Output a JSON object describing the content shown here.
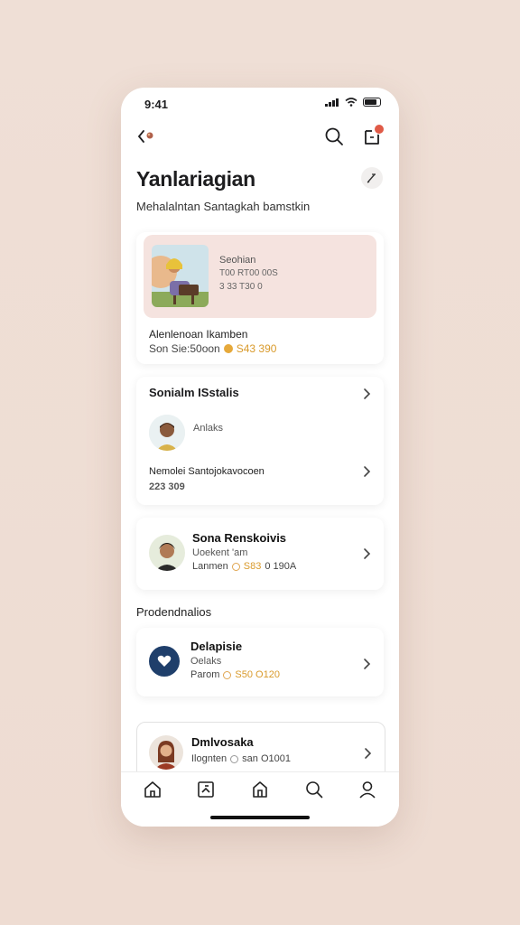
{
  "status_bar": {
    "time": "9:41"
  },
  "header": {
    "title": "Yanlariagian",
    "subtitle": "Mehalalntan Santagkah bamstkin"
  },
  "featured_card": {
    "hero_name": "Seohian",
    "hero_line1": "T00 RT00 00S",
    "hero_line2": "3 33 T30 0",
    "title": "Alenlenoan Ikamben",
    "subtitle_prefix": "Son Sie:50oon",
    "amount": "S43 390"
  },
  "section_card": {
    "title": "Sonialm ISstalis",
    "person_label": "Anlaks",
    "footer_label": "Nemolei Santojokavocoen",
    "footer_amount": "223 309"
  },
  "person_card": {
    "name": "Sona Renskoivis",
    "line1": "Uoekent 'am",
    "line2_prefix": "Lanmen",
    "line2_amount": "S83",
    "line2_suffix": "0 190A"
  },
  "section_heading": "Prodendnalios",
  "heart_card": {
    "name": "Delapisie",
    "line1": "Oelaks",
    "line2_prefix": "Parom",
    "line2_amount": "S50 O120"
  },
  "last_card": {
    "name": "Dmlvosaka",
    "line2_prefix": "Ilognten",
    "line2_suffix": "san O1001"
  },
  "colors": {
    "background": "#eedcd2",
    "accent_gold": "#d99a2b",
    "hero_bg": "#f5e3df",
    "heart_navy": "#1f3f6b",
    "notification_red": "#e05a47"
  },
  "icons": {
    "back": "chevron-left-icon",
    "search": "search-icon",
    "notification": "bell-icon",
    "edit": "pencil-icon",
    "tabs": [
      "home-icon",
      "image-icon",
      "house-icon",
      "search-icon",
      "profile-icon"
    ]
  }
}
